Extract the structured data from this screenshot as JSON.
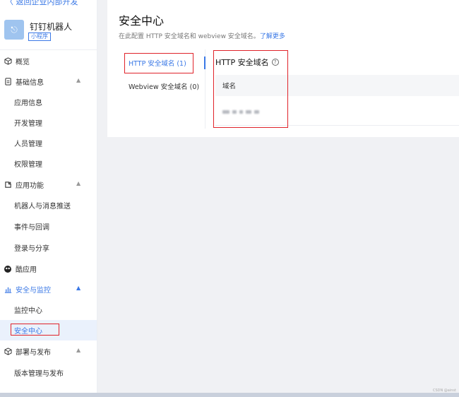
{
  "sidebar": {
    "back_label": "〈 返回企业内部开发",
    "app": {
      "logo_glyph": "⎋",
      "name": "钉钉机器人",
      "badge": "小程序"
    },
    "items": [
      {
        "label": "概览",
        "icon": "cube-icon",
        "type": "top"
      },
      {
        "label": "基础信息",
        "icon": "doc-icon",
        "type": "group",
        "expanded": true
      },
      {
        "label": "应用信息",
        "type": "sub"
      },
      {
        "label": "开发管理",
        "type": "sub"
      },
      {
        "label": "人员管理",
        "type": "sub"
      },
      {
        "label": "权限管理",
        "type": "sub"
      },
      {
        "label": "应用功能",
        "icon": "puzzle-icon",
        "type": "group",
        "expanded": true
      },
      {
        "label": "机器人与消息推送",
        "type": "sub"
      },
      {
        "label": "事件与回调",
        "type": "sub"
      },
      {
        "label": "登录与分享",
        "type": "sub"
      },
      {
        "label": "酷应用",
        "icon": "cool-app-icon",
        "type": "top"
      },
      {
        "label": "安全与监控",
        "icon": "bar-chart-icon",
        "type": "group",
        "expanded": true,
        "active_group": true
      },
      {
        "label": "监控中心",
        "type": "sub"
      },
      {
        "label": "安全中心",
        "type": "sub",
        "active": true
      },
      {
        "label": "部署与发布",
        "icon": "cube-icon",
        "type": "group",
        "expanded": true
      },
      {
        "label": "版本管理与发布",
        "type": "sub"
      }
    ]
  },
  "main": {
    "title": "安全中心",
    "description": "在此配置 HTTP 安全域名和 webview 安全域名。",
    "learn_more": "了解更多",
    "tabs": [
      {
        "label": "HTTP 安全域名 (1)",
        "active": true
      },
      {
        "label": "Webview 安全域名 (0)",
        "active": false
      }
    ],
    "section_title": "HTTP 安全域名",
    "help_glyph": "?",
    "table": {
      "columns": [
        "域名"
      ],
      "rows": [
        [
          "(blurred domain)"
        ]
      ]
    }
  },
  "watermark": "CSDN @ainst",
  "colors": {
    "accent": "#3a78e6",
    "annotation_red": "#e0232a"
  }
}
